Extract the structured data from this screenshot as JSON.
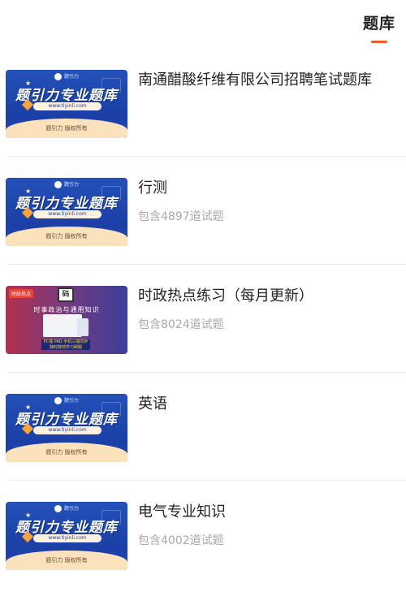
{
  "header": {
    "tab_label": "题库",
    "accent": "#f05a2a"
  },
  "thumbs": {
    "promo_title": "题引力专业题库",
    "promo_url": "www.tiyinli.com",
    "promo_footer": "题引力 版权所有",
    "promo_logo": "题引力",
    "news_tag": "时政热点",
    "news_title": "时事政治与通用知识",
    "news_band": "PC端 PAD 手机三端同步 随时随地学习刷题"
  },
  "items": [
    {
      "title": "南通醋酸纤维有限公司招聘笔试题库",
      "subtitle": "",
      "thumb": "promo"
    },
    {
      "title": "行测",
      "subtitle": "包含4897道试题",
      "thumb": "promo"
    },
    {
      "title": "时政热点练习（每月更新）",
      "subtitle": "包含8024道试题",
      "thumb": "news"
    },
    {
      "title": "英语",
      "subtitle": "",
      "thumb": "promo"
    },
    {
      "title": "电气专业知识",
      "subtitle": "包含4002道试题",
      "thumb": "promo"
    }
  ]
}
